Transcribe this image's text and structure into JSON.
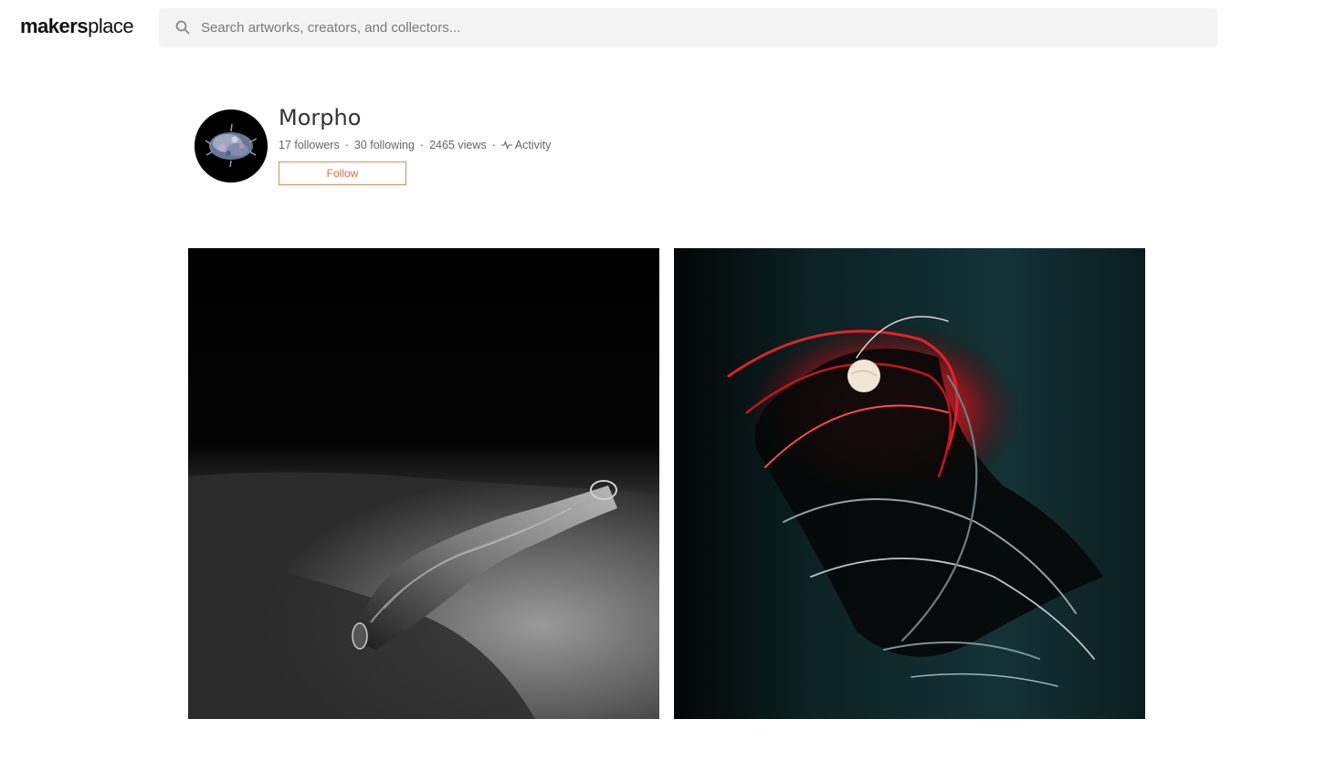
{
  "header": {
    "logo_bold": "makers",
    "logo_light": "place",
    "search_placeholder": "Search artworks, creators, and collectors..."
  },
  "profile": {
    "name": "Morpho",
    "followers": "17 followers",
    "following": "30 following",
    "views": "2465 views",
    "activity": "Activity",
    "follow_label": "Follow"
  },
  "gallery": {
    "artworks": [
      {
        "icon": "abstract-sculpture-grayscale"
      },
      {
        "icon": "abstract-tangle-red-teal"
      }
    ]
  },
  "colors": {
    "accent": "#d9703e",
    "search_bg": "#f3f3f3",
    "text_muted": "#666666",
    "art2_bg": "#0f2a2c",
    "art2_red": "#c4161c"
  }
}
